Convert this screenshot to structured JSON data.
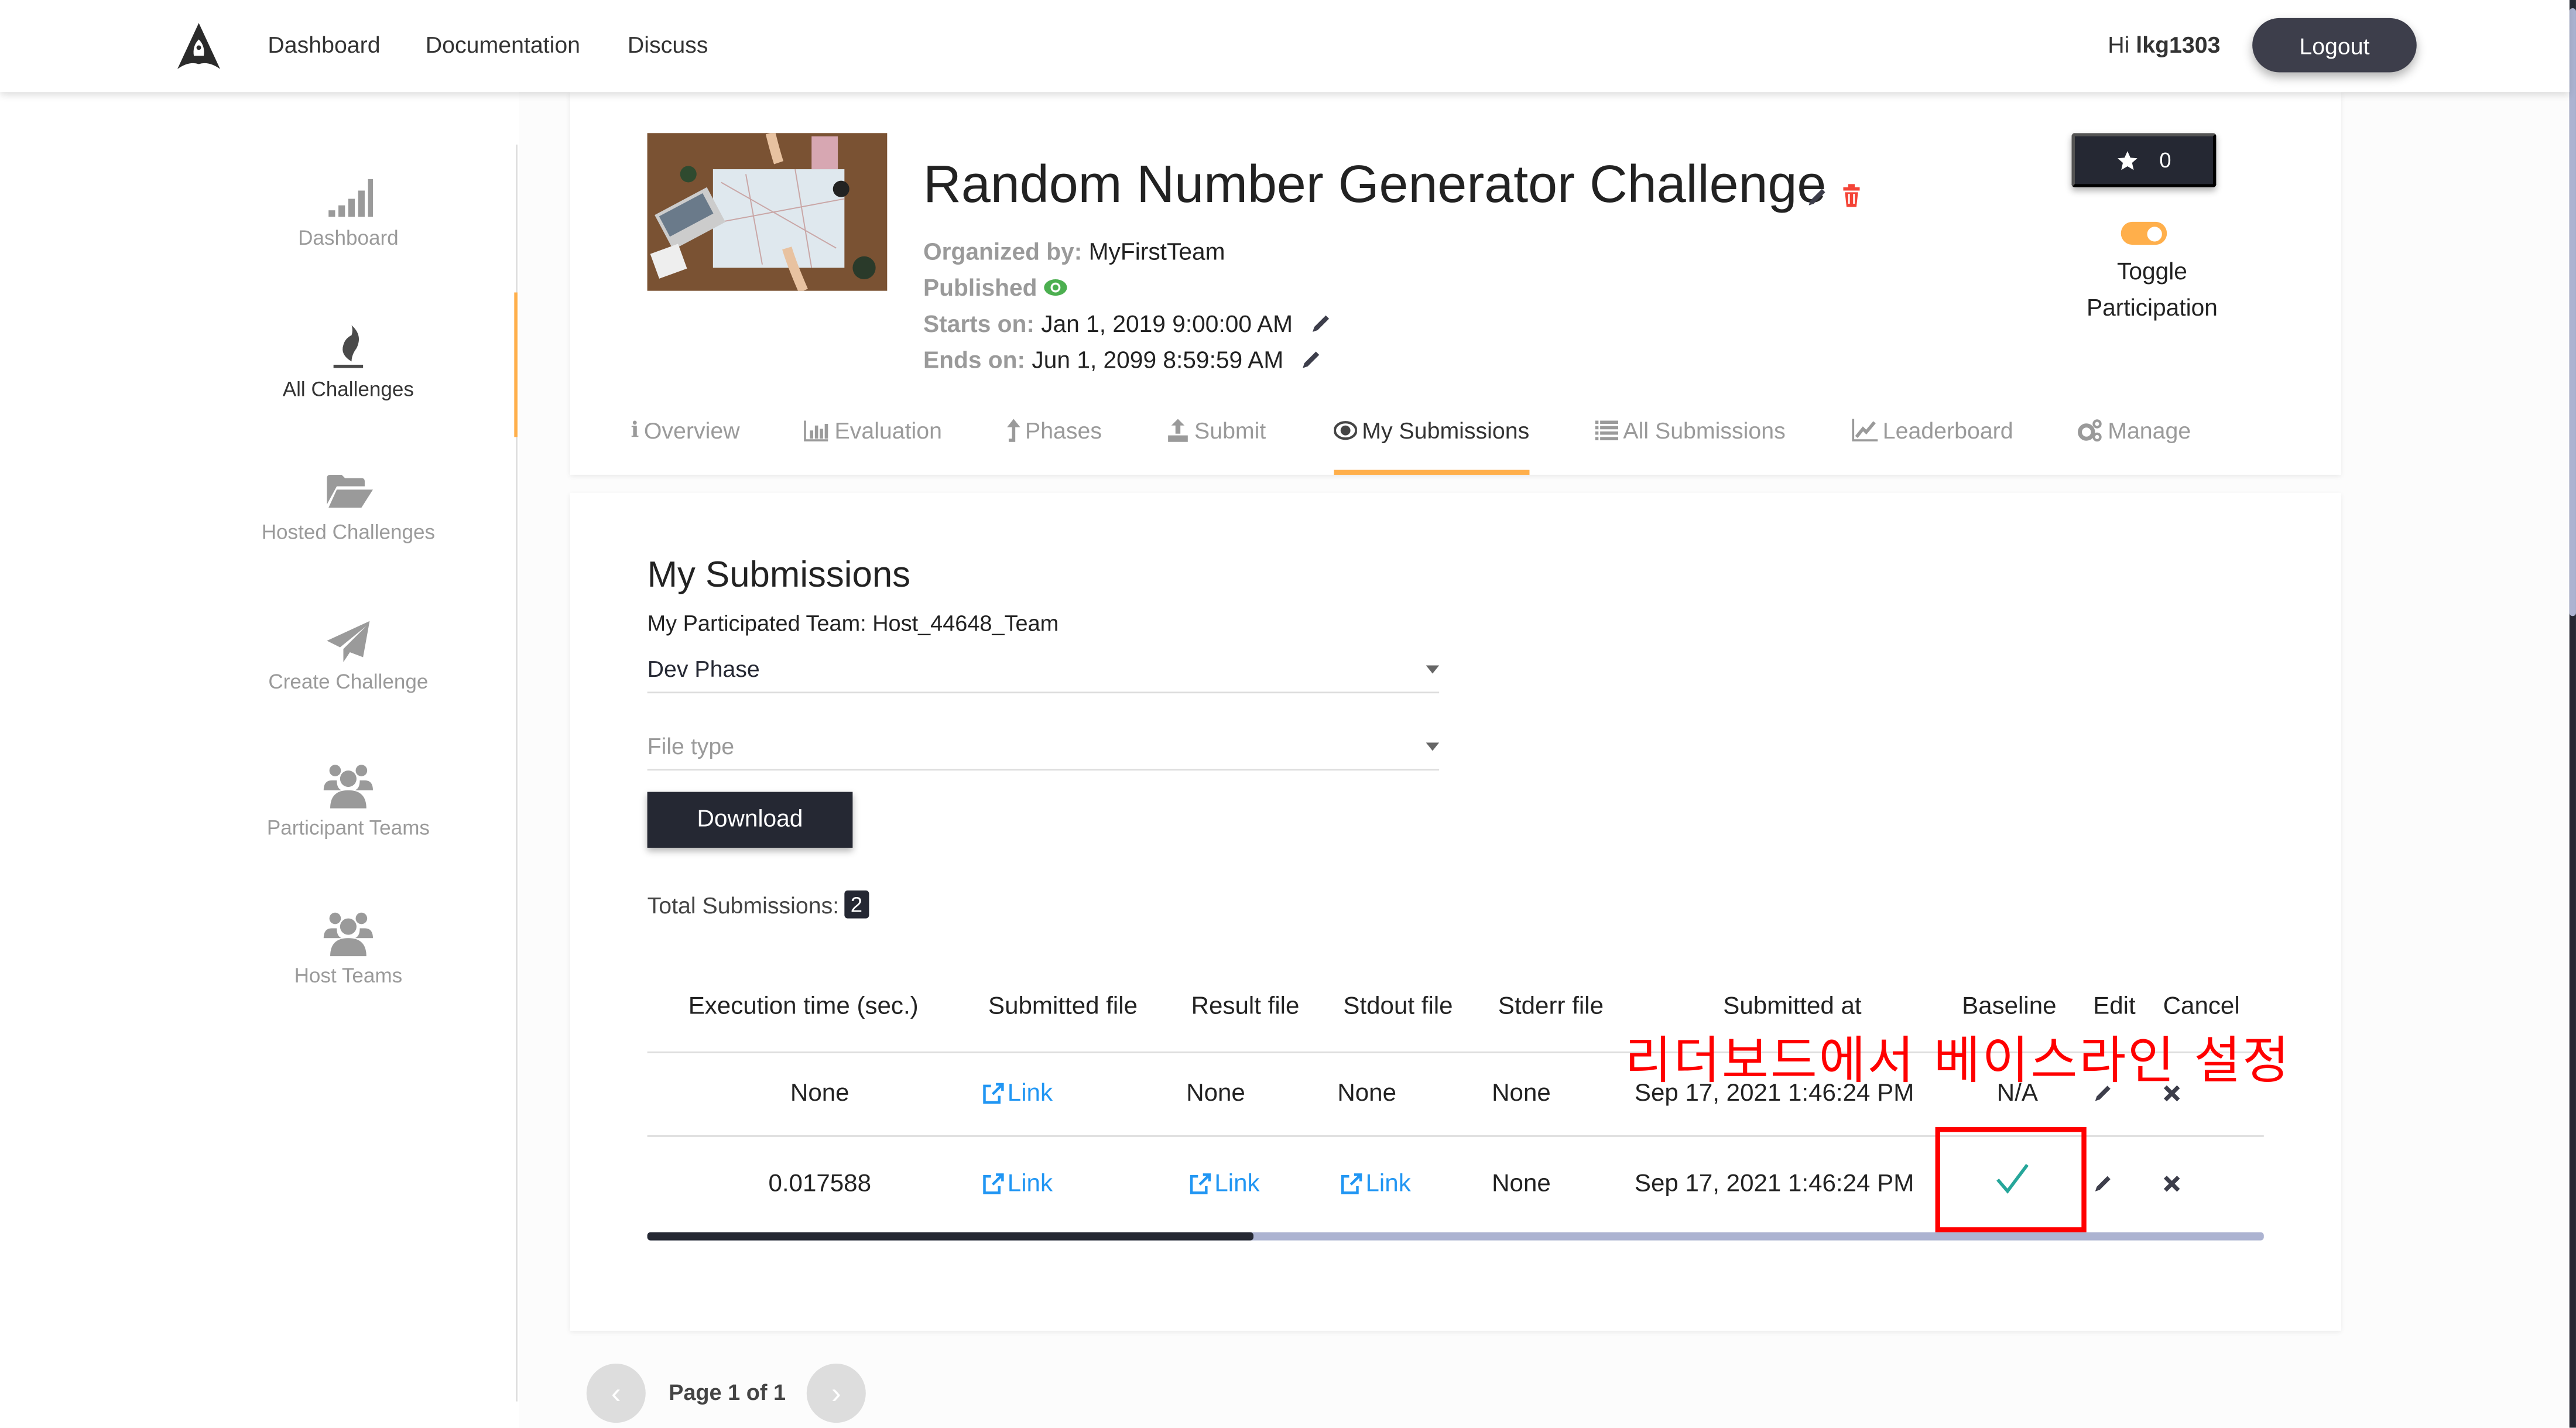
{
  "header": {
    "nav": [
      "Dashboard",
      "Documentation",
      "Discuss"
    ],
    "greeting_prefix": "Hi",
    "username": "lkg1303",
    "logout_label": "Logout"
  },
  "sidebar": {
    "items": [
      {
        "label": "Dashboard",
        "icon": "signal-bars-icon",
        "active": false
      },
      {
        "label": "All Challenges",
        "icon": "fire-icon",
        "active": true
      },
      {
        "label": "Hosted Challenges",
        "icon": "folder-open-icon",
        "active": false
      },
      {
        "label": "Create Challenge",
        "icon": "paper-plane-icon",
        "active": false
      },
      {
        "label": "Participant Teams",
        "icon": "users-icon",
        "active": false
      },
      {
        "label": "Host Teams",
        "icon": "users-icon",
        "active": false
      }
    ]
  },
  "challenge": {
    "title": "Random Number Generator Challenge",
    "organized_label": "Organized by:",
    "organizer": "MyFirstTeam",
    "published_label": "Published",
    "starts_label": "Starts on:",
    "starts_value": "Jan 1, 2019 9:00:00 AM",
    "ends_label": "Ends on:",
    "ends_value": "Jun 1, 2099 8:59:59 AM",
    "star_count": "0",
    "toggle_label_1": "Toggle",
    "toggle_label_2": "Participation",
    "participation_on": true
  },
  "tabs": [
    {
      "label": "Overview",
      "icon": "info-icon"
    },
    {
      "label": "Evaluation",
      "icon": "bar-chart-icon"
    },
    {
      "label": "Phases",
      "icon": "arrow-up-icon"
    },
    {
      "label": "Submit",
      "icon": "upload-icon"
    },
    {
      "label": "My Submissions",
      "icon": "eye-icon",
      "active": true
    },
    {
      "label": "All Submissions",
      "icon": "list-icon"
    },
    {
      "label": "Leaderboard",
      "icon": "line-chart-icon"
    },
    {
      "label": "Manage",
      "icon": "gears-icon"
    }
  ],
  "submissions": {
    "heading": "My Submissions",
    "team_label": "My Participated Team: Host_44648_Team",
    "phase_select": "Dev Phase",
    "file_type_placeholder": "File type",
    "download_label": "Download",
    "total_label": "Total Submissions:",
    "total_count": "2",
    "columns": [
      "Execution time (sec.)",
      "Submitted file",
      "Result file",
      "Stdout file",
      "Stderr file",
      "Submitted at",
      "Baseline",
      "Edit",
      "Cancel"
    ],
    "rows": [
      {
        "exec_time": "None",
        "submitted_file": "Link",
        "result_file": "None",
        "stdout_file": "None",
        "stderr_file": "None",
        "submitted_at": "Sep 17, 2021 1:46:24 PM",
        "baseline": "N/A"
      },
      {
        "exec_time": "0.017588",
        "submitted_file": "Link",
        "result_file": "Link",
        "stdout_file": "Link",
        "stderr_file": "None",
        "submitted_at": "Sep 17, 2021 1:46:24 PM",
        "baseline": "✓"
      }
    ],
    "table_scroll_fraction": 0.375
  },
  "annotation": {
    "text": "리더보드에서 베이스라인 설정",
    "color": "#ff0000"
  },
  "pagination": {
    "text": "Page 1 of 1",
    "prev": "‹",
    "next": "›"
  },
  "colors": {
    "accent": "#ffaf4b",
    "dark": "#252833",
    "link": "#2196f3",
    "check": "#26a69a",
    "delete": "#f44336",
    "published": "#4caf50"
  }
}
